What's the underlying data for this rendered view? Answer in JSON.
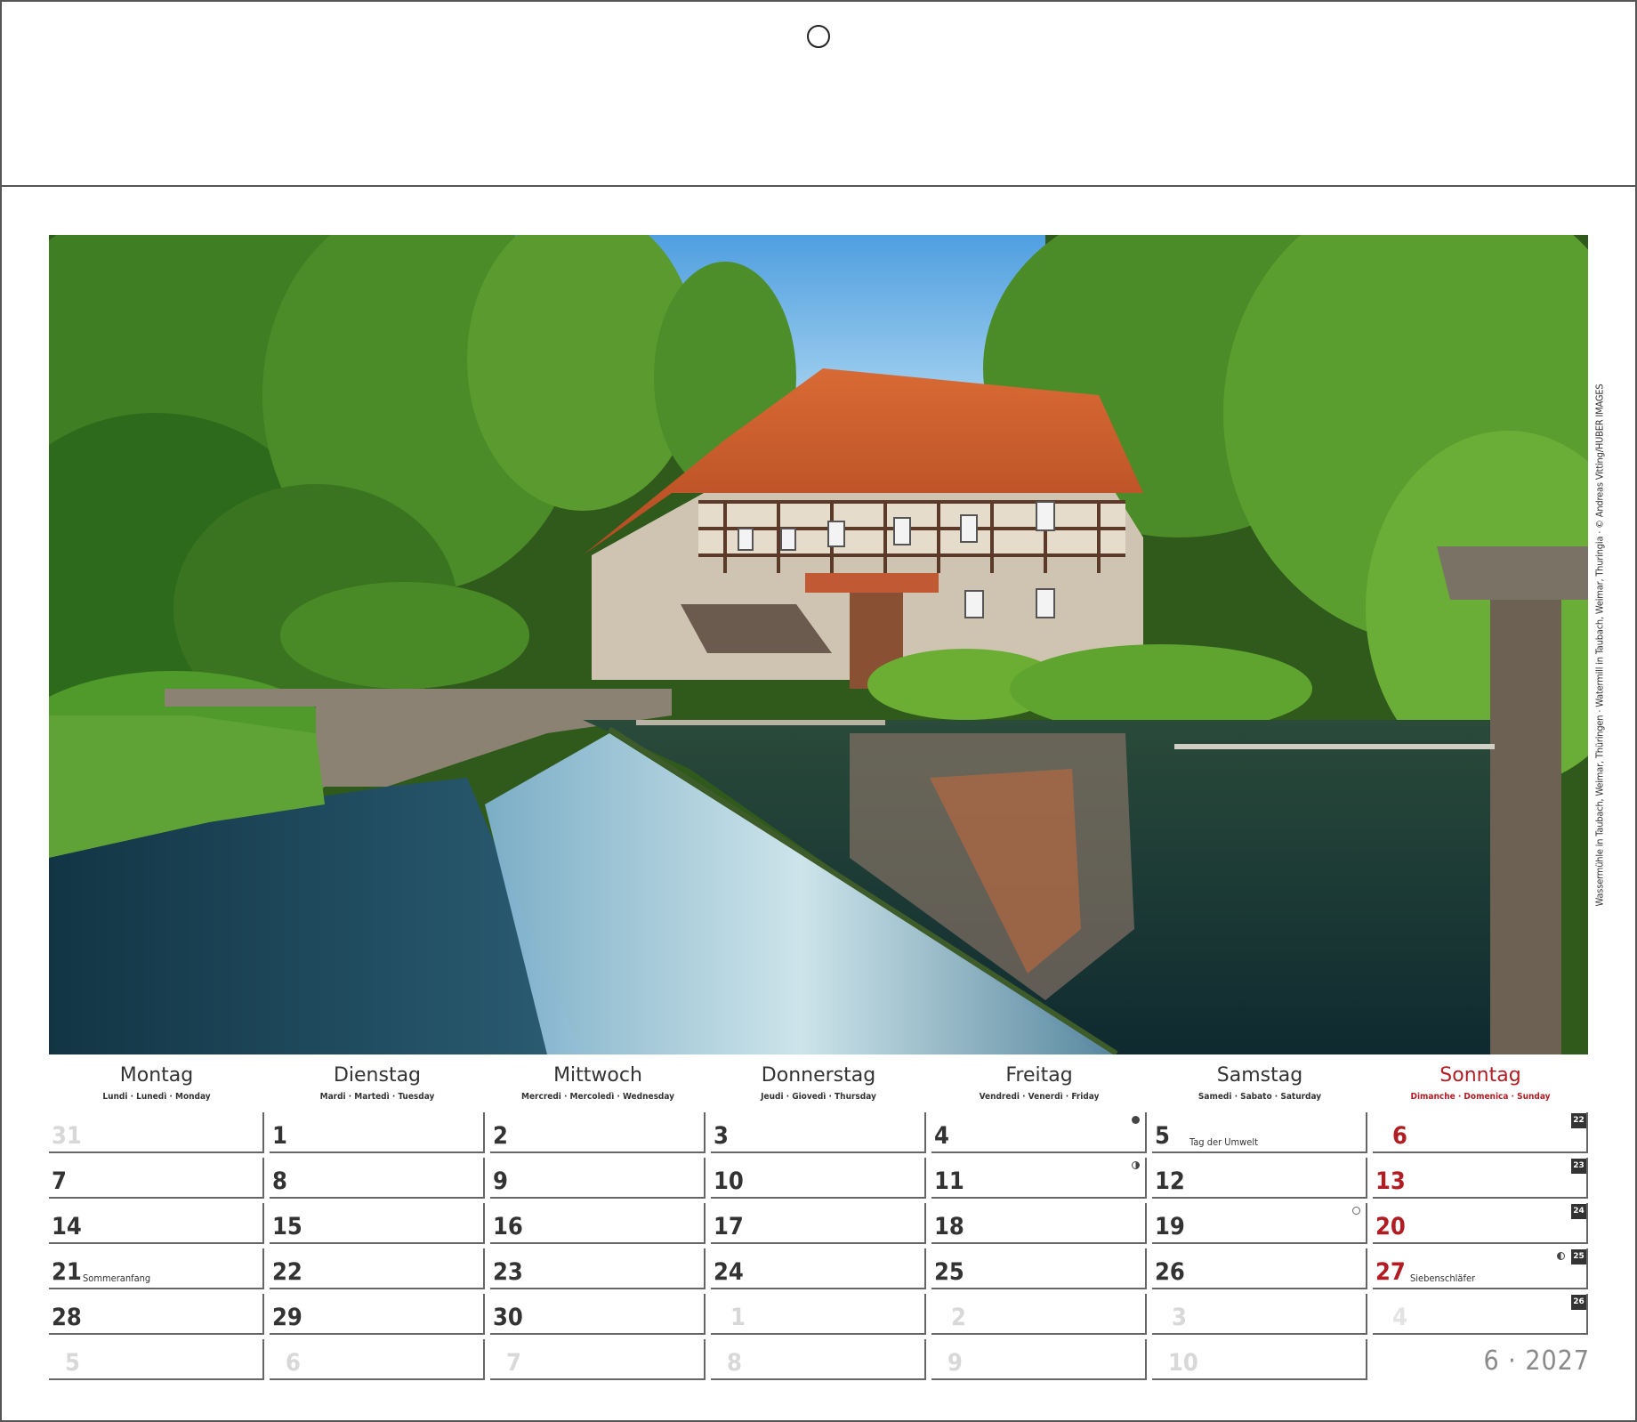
{
  "photo": {
    "subject": "watermill-photo"
  },
  "credit": "Wassermühle in Taubach, Weimar, Thüringen · Watermill in Taubach, Weimar, Thuringia · © Andreas Vitting/HUBER IMAGES",
  "weekdays": [
    {
      "name": "Montag",
      "langs": "Lundi · Lunedì · Monday"
    },
    {
      "name": "Dienstag",
      "langs": "Mardi · Martedì · Tuesday"
    },
    {
      "name": "Mittwoch",
      "langs": "Mercredi · Mercoledì · Wednesday"
    },
    {
      "name": "Donnerstag",
      "langs": "Jeudi · Giovedì · Thursday"
    },
    {
      "name": "Freitag",
      "langs": "Vendredi · Venerdì · Friday"
    },
    {
      "name": "Samstag",
      "langs": "Samedi · Sabato · Saturday"
    },
    {
      "name": "Sonntag",
      "langs": "Dimanche · Domenica · Sunday"
    }
  ],
  "weeks": [
    {
      "week": "22",
      "days": [
        "31",
        "1",
        "2",
        "3",
        "4",
        "5",
        "6"
      ]
    },
    {
      "week": "23",
      "days": [
        "7",
        "8",
        "9",
        "10",
        "11",
        "12",
        "13"
      ]
    },
    {
      "week": "24",
      "days": [
        "14",
        "15",
        "16",
        "17",
        "18",
        "19",
        "20"
      ]
    },
    {
      "week": "25",
      "days": [
        "21",
        "22",
        "23",
        "24",
        "25",
        "26",
        "27"
      ]
    },
    {
      "week": "26",
      "days": [
        "28",
        "29",
        "30",
        "1",
        "2",
        "3",
        "4"
      ]
    },
    {
      "week": "",
      "days": [
        "5",
        "6",
        "7",
        "8",
        "9",
        "10",
        ""
      ]
    }
  ],
  "notes": {
    "tag_der_umwelt": "Tag der Umwelt",
    "sommeranfang": "Sommeranfang",
    "siebenschlaefer": "Siebenschläfer"
  },
  "month_label": "6 · 2027",
  "colors": {
    "sunday": "#b21d24",
    "text": "#333333",
    "muted": "#d8d8d8"
  }
}
